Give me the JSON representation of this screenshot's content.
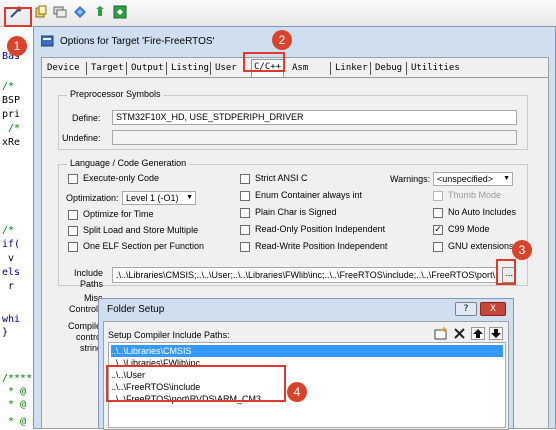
{
  "editor": {
    "code_lines": [
      "Bas",
      "/*",
      "BSP",
      "pri",
      " /*",
      "xRe",
      "/*",
      "if(",
      " v",
      "els",
      " r",
      "whi",
      "}",
      "/****",
      " * @",
      " * @",
      " * @ 参数     :"
    ]
  },
  "toolbar": {
    "icons": [
      "target-options-icon",
      "file-icon",
      "stack-icon",
      "diamond-icon",
      "settings-icon",
      "component-icon"
    ]
  },
  "options_dialog": {
    "title": "Options for Target 'Fire-FreeRTOS'",
    "tabs": [
      "Device",
      "Target",
      "Output",
      "Listing",
      "User",
      "C/C++",
      "Asm",
      "Linker",
      "Debug",
      "Utilities"
    ],
    "active_tab": "C/C++",
    "preprocessor": {
      "group_label": "Preprocessor Symbols",
      "define_label": "Define:",
      "define_value": "STM32F10X_HD, USE_STDPERIPH_DRIVER",
      "undefine_label": "Undefine:",
      "undefine_value": ""
    },
    "language": {
      "group_label": "Language / Code Generation",
      "execute_only": "Execute-only Code",
      "optimization_label": "Optimization:",
      "optimization_value": "Level 1 (-O1)",
      "optimize_time": "Optimize for Time",
      "split_load": "Split Load and Store Multiple",
      "one_elf": "One ELF Section per Function",
      "strict_ansi": "Strict ANSI C",
      "enum_container": "Enum Container always int",
      "plain_char": "Plain Char is Signed",
      "ro_pi": "Read-Only Position Independent",
      "rw_pi": "Read-Write Position Independent",
      "warnings_label": "Warnings:",
      "warnings_value": "<unspecified>",
      "thumb_mode": "Thumb Mode",
      "no_auto_includes": "No Auto Includes",
      "c99_mode": "C99 Mode",
      "gnu_extensions": "GNU extensions"
    },
    "include_label_1": "Include",
    "include_label_2": "Paths",
    "include_value": ".\\..\\Libraries\\CMSIS;..\\..\\User;..\\..\\Libraries\\FWlib\\inc;..\\..\\FreeRTOS\\include;..\\..\\FreeRTOS\\port\\",
    "browse_label": "...",
    "misc_label_1": "Misc",
    "misc_label_2": "Controls",
    "compiler_label_1": "Compiler",
    "compiler_label_2": "control",
    "compiler_label_3": "string"
  },
  "folder_setup": {
    "title": "Folder Setup",
    "help_btn": "?",
    "close_btn": "X",
    "list_label": "Setup Compiler Include Paths:",
    "items": [
      "..\\..\\Libraries\\CMSIS",
      "..\\..\\Libraries\\FWlib\\inc",
      "..\\..\\User",
      "..\\..\\FreeRTOS\\include",
      "..\\..\\FreeRTOS\\port\\RVDS\\ARM_CM3"
    ],
    "selected_index": 0,
    "tool_icons": [
      "new-folder-icon",
      "delete-icon",
      "move-up-icon",
      "move-down-icon"
    ]
  },
  "annotations": {
    "markers": [
      "1",
      "2",
      "3",
      "4"
    ],
    "color": "#e0392b"
  }
}
